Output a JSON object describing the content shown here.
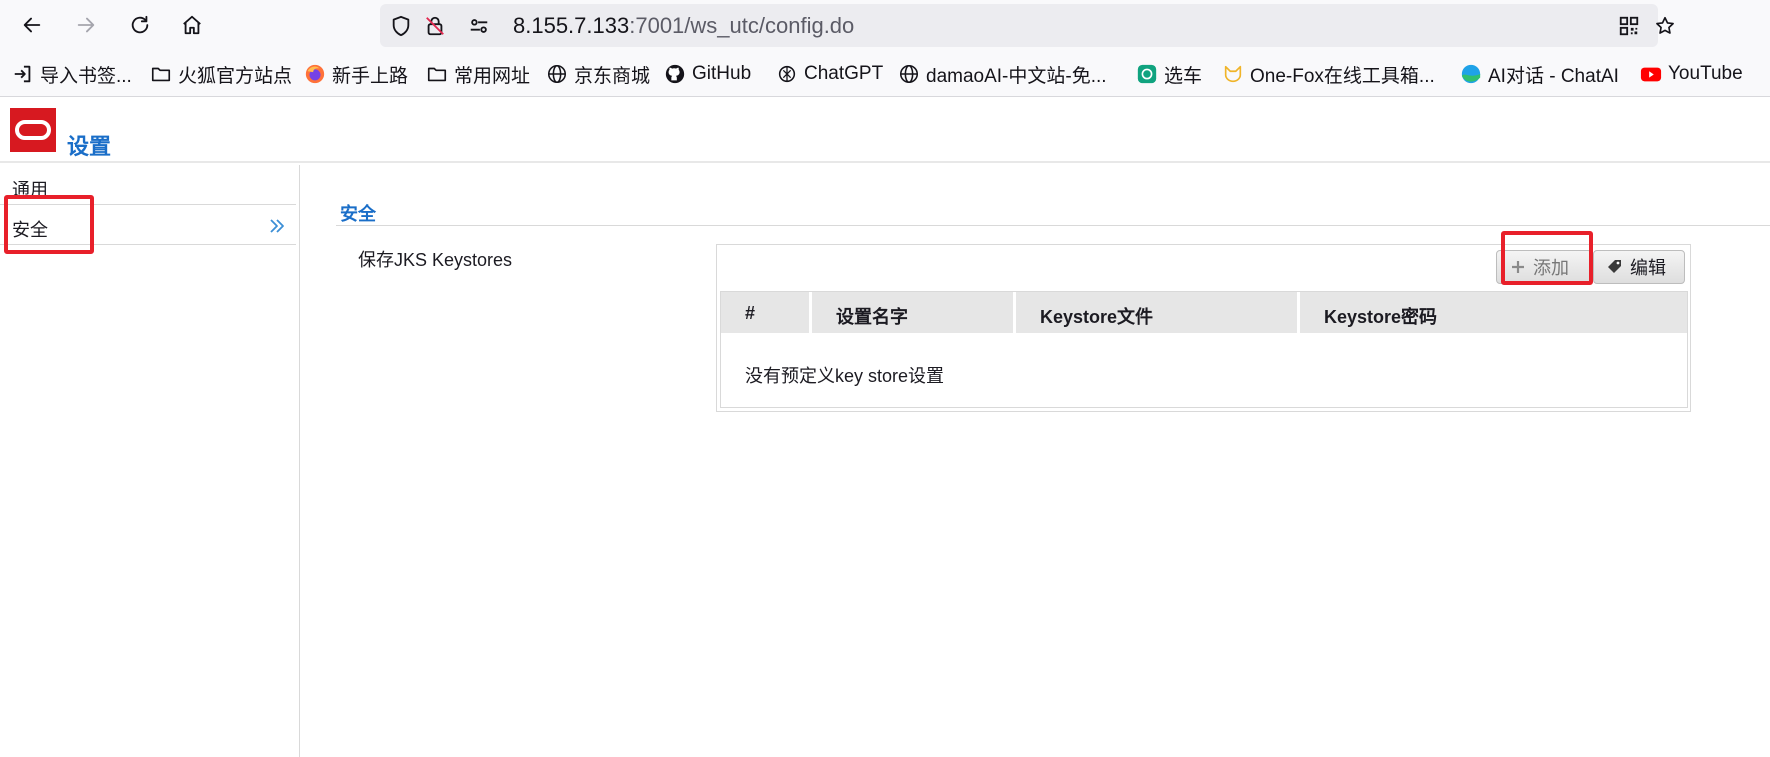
{
  "browser": {
    "url_host": "8.155.7.133",
    "url_rest": ":7001/ws_utc/config.do",
    "icons": [
      "back-icon",
      "forward-icon",
      "reload-icon",
      "home-icon",
      "shield-icon",
      "no-lock-icon",
      "permissions-icon",
      "qr-code-icon",
      "star-icon"
    ]
  },
  "bookmarks": [
    {
      "label": "导入书签...",
      "icon": "import-icon"
    },
    {
      "label": "火狐官方站点",
      "icon": "folder-icon"
    },
    {
      "label": "新手上路",
      "icon": "firefox-icon"
    },
    {
      "label": "常用网址",
      "icon": "folder-icon"
    },
    {
      "label": "京东商城",
      "icon": "globe-icon"
    },
    {
      "label": "GitHub",
      "icon": "github-icon"
    },
    {
      "label": "ChatGPT",
      "icon": "chatgpt-icon"
    },
    {
      "label": "damaoAI-中文站-免...",
      "icon": "globe-icon"
    },
    {
      "label": "选车",
      "icon": "openai-icon"
    },
    {
      "label": "One-Fox在线工具箱...",
      "icon": "fox-icon"
    },
    {
      "label": "AI对话 - ChatAI",
      "icon": "chatai-icon"
    },
    {
      "label": "YouTube",
      "icon": "youtube-icon"
    }
  ],
  "app": {
    "title": "设置",
    "brand_color": "#d71920",
    "accent_color": "#1a6ec8"
  },
  "nav": {
    "items": [
      {
        "label": "通用",
        "active": false
      },
      {
        "label": "安全",
        "active": true
      }
    ]
  },
  "section": {
    "title": "安全",
    "field_label": "保存JKS Keystores"
  },
  "keystores": {
    "add_label": "添加",
    "edit_label": "编辑",
    "columns": [
      "#",
      "设置名字",
      "Keystore文件",
      "Keystore密码"
    ],
    "rows": [],
    "empty_message": "没有预定义key store设置"
  },
  "annotations": {
    "highlight_color": "#e8202a"
  }
}
